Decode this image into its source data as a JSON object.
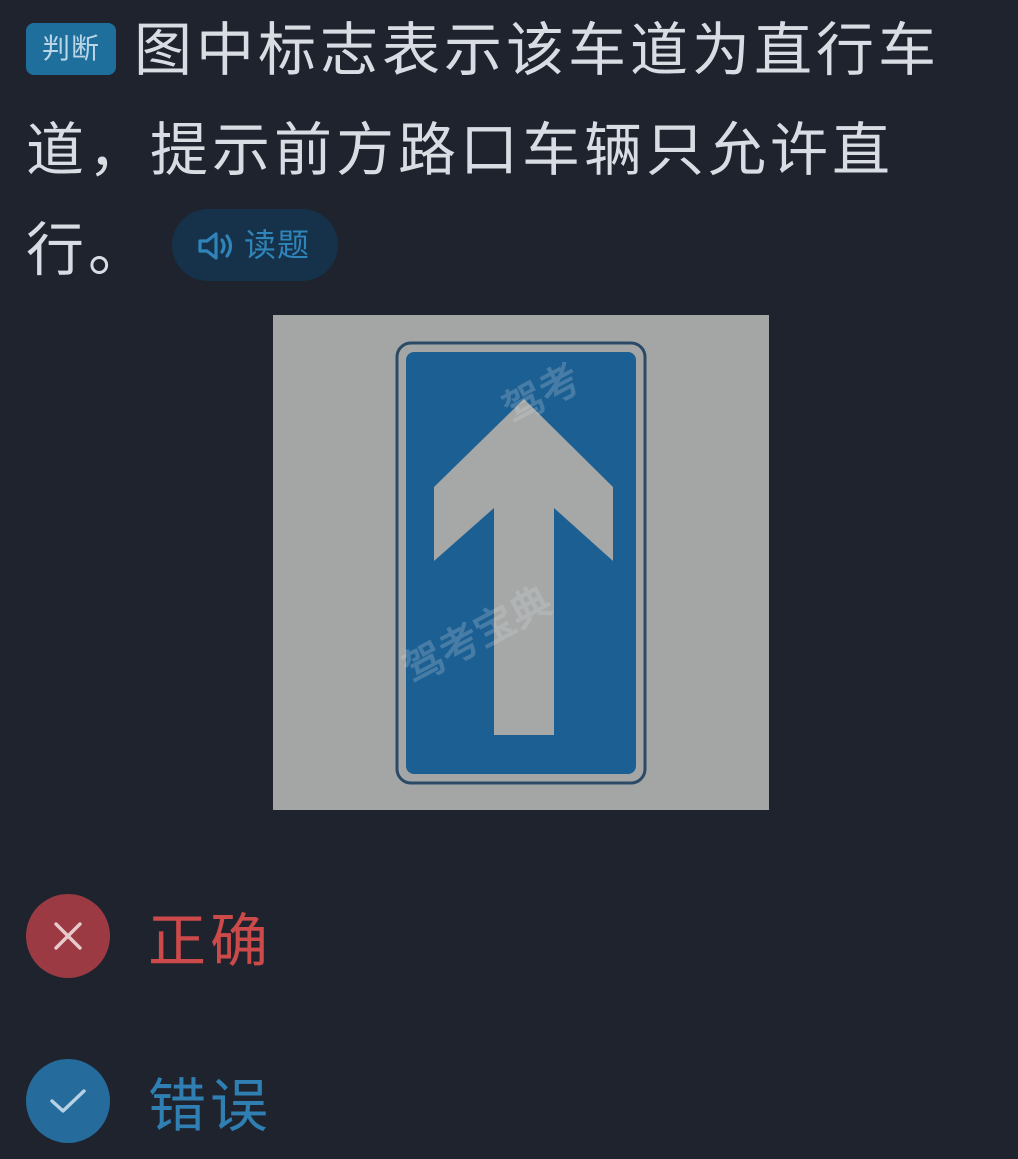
{
  "question": {
    "type_tag": "判断",
    "text": "图中标志表示该车道为直行车道，提示前方路口车辆只允许直行。",
    "read_button_label": "读题",
    "read_icon": "speaker-icon"
  },
  "image": {
    "description_icon": "straight-lane-sign",
    "watermark": "驾考宝典",
    "colors": {
      "background": "#a4a5a5",
      "sign_blue": "#1c5f92",
      "arrow": "#a6a7a7"
    }
  },
  "options": [
    {
      "label": "正确",
      "icon": "close-icon",
      "icon_bg": "#9c3a43",
      "label_color": "#cc4a4a",
      "state": "selected-wrong"
    },
    {
      "label": "错误",
      "icon": "check-icon",
      "icon_bg": "#256b9b",
      "label_color": "#2f7fb3",
      "state": "correct"
    }
  ],
  "colors": {
    "background": "#1e232e",
    "text": "#d9dde3",
    "accent": "#2f84b9"
  }
}
